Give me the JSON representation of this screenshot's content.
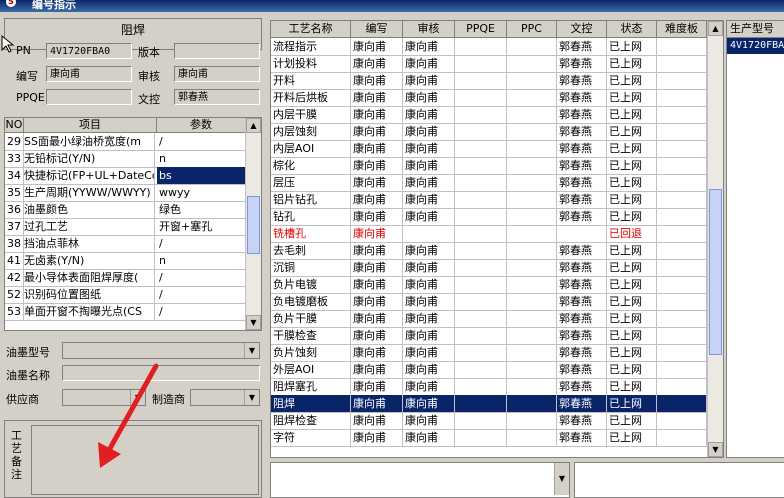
{
  "window": {
    "title": "编号指示"
  },
  "left_panel": {
    "section_title": "阻焊",
    "fields": {
      "pn_label": "PN",
      "pn_value": "4V1720FBA0",
      "version_label": "版本",
      "version_value": "",
      "author_label": "编写",
      "author_value": "康向甫",
      "reviewer_label": "审核",
      "reviewer_value": "康向甫",
      "ppqe_label": "PPQE",
      "ppqe_value": "",
      "control_label": "文控",
      "control_value": "郭春燕"
    },
    "param_table": {
      "headers": [
        "NO",
        "项目",
        "参数"
      ],
      "rows": [
        {
          "no": "29",
          "item": "SS面最小绿油桥宽度(m",
          "val": "/"
        },
        {
          "no": "33",
          "item": "无铅标记(Y/N)",
          "val": "n"
        },
        {
          "no": "34",
          "item": "快捷标记(FP+UL+DateCo",
          "val": "bs",
          "selected": true
        },
        {
          "no": "35",
          "item": "生产周期(YYWW/WWYY)",
          "val": "wwyy"
        },
        {
          "no": "36",
          "item": "油墨颜色",
          "val": "绿色"
        },
        {
          "no": "37",
          "item": "过孔工艺",
          "val": "开窗+塞孔"
        },
        {
          "no": "38",
          "item": "挡油点菲林",
          "val": "/"
        },
        {
          "no": "41",
          "item": "无卤素(Y/N)",
          "val": "n"
        },
        {
          "no": "42",
          "item": "最小导体表面阻焊厚度(",
          "val": "/"
        },
        {
          "no": "52",
          "item": "识别码位置图纸",
          "val": "/"
        },
        {
          "no": "53",
          "item": "单面开窗不掏曝光点(CS",
          "val": "/"
        }
      ]
    },
    "ink_model_label": "油墨型号",
    "ink_name_label": "油墨名称",
    "supplier_label": "供应商",
    "manufacturer_label": "制造商",
    "memo_label": "工艺备注"
  },
  "grid": {
    "headers": [
      "工艺名称",
      "编写",
      "审核",
      "PPQE",
      "PPC",
      "文控",
      "状态",
      "难度板"
    ],
    "rows": [
      {
        "name": "流程指示",
        "author": "康向甫",
        "reviewer": "康向甫",
        "ppqe": "",
        "ppc": "",
        "control": "郭春燕",
        "status": "已上网",
        "diff": ""
      },
      {
        "name": "计划投料",
        "author": "康向甫",
        "reviewer": "康向甫",
        "ppqe": "",
        "ppc": "",
        "control": "郭春燕",
        "status": "已上网",
        "diff": ""
      },
      {
        "name": "开料",
        "author": "康向甫",
        "reviewer": "康向甫",
        "ppqe": "",
        "ppc": "",
        "control": "郭春燕",
        "status": "已上网",
        "diff": ""
      },
      {
        "name": "开料后烘板",
        "author": "康向甫",
        "reviewer": "康向甫",
        "ppqe": "",
        "ppc": "",
        "control": "郭春燕",
        "status": "已上网",
        "diff": ""
      },
      {
        "name": "内层干膜",
        "author": "康向甫",
        "reviewer": "康向甫",
        "ppqe": "",
        "ppc": "",
        "control": "郭春燕",
        "status": "已上网",
        "diff": ""
      },
      {
        "name": "内层蚀刻",
        "author": "康向甫",
        "reviewer": "康向甫",
        "ppqe": "",
        "ppc": "",
        "control": "郭春燕",
        "status": "已上网",
        "diff": ""
      },
      {
        "name": "内层AOI",
        "author": "康向甫",
        "reviewer": "康向甫",
        "ppqe": "",
        "ppc": "",
        "control": "郭春燕",
        "status": "已上网",
        "diff": ""
      },
      {
        "name": "棕化",
        "author": "康向甫",
        "reviewer": "康向甫",
        "ppqe": "",
        "ppc": "",
        "control": "郭春燕",
        "status": "已上网",
        "diff": ""
      },
      {
        "name": "层压",
        "author": "康向甫",
        "reviewer": "康向甫",
        "ppqe": "",
        "ppc": "",
        "control": "郭春燕",
        "status": "已上网",
        "diff": ""
      },
      {
        "name": "铝片钻孔",
        "author": "康向甫",
        "reviewer": "康向甫",
        "ppqe": "",
        "ppc": "",
        "control": "郭春燕",
        "status": "已上网",
        "diff": ""
      },
      {
        "name": "钻孔",
        "author": "康向甫",
        "reviewer": "康向甫",
        "ppqe": "",
        "ppc": "",
        "control": "郭春燕",
        "status": "已上网",
        "diff": ""
      },
      {
        "name": "铣槽孔",
        "author": "康向甫",
        "reviewer": "",
        "ppqe": "",
        "ppc": "",
        "control": "",
        "status": "已回退",
        "diff": "",
        "red": true
      },
      {
        "name": "去毛刺",
        "author": "康向甫",
        "reviewer": "康向甫",
        "ppqe": "",
        "ppc": "",
        "control": "郭春燕",
        "status": "已上网",
        "diff": ""
      },
      {
        "name": "沉铜",
        "author": "康向甫",
        "reviewer": "康向甫",
        "ppqe": "",
        "ppc": "",
        "control": "郭春燕",
        "status": "已上网",
        "diff": ""
      },
      {
        "name": "负片电镀",
        "author": "康向甫",
        "reviewer": "康向甫",
        "ppqe": "",
        "ppc": "",
        "control": "郭春燕",
        "status": "已上网",
        "diff": ""
      },
      {
        "name": "负电镀磨板",
        "author": "康向甫",
        "reviewer": "康向甫",
        "ppqe": "",
        "ppc": "",
        "control": "郭春燕",
        "status": "已上网",
        "diff": ""
      },
      {
        "name": "负片干膜",
        "author": "康向甫",
        "reviewer": "康向甫",
        "ppqe": "",
        "ppc": "",
        "control": "郭春燕",
        "status": "已上网",
        "diff": ""
      },
      {
        "name": "干膜检查",
        "author": "康向甫",
        "reviewer": "康向甫",
        "ppqe": "",
        "ppc": "",
        "control": "郭春燕",
        "status": "已上网",
        "diff": ""
      },
      {
        "name": "负片蚀刻",
        "author": "康向甫",
        "reviewer": "康向甫",
        "ppqe": "",
        "ppc": "",
        "control": "郭春燕",
        "status": "已上网",
        "diff": ""
      },
      {
        "name": "外层AOI",
        "author": "康向甫",
        "reviewer": "康向甫",
        "ppqe": "",
        "ppc": "",
        "control": "郭春燕",
        "status": "已上网",
        "diff": ""
      },
      {
        "name": "阻焊塞孔",
        "author": "康向甫",
        "reviewer": "康向甫",
        "ppqe": "",
        "ppc": "",
        "control": "郭春燕",
        "status": "已上网",
        "diff": ""
      },
      {
        "name": "阻焊",
        "author": "康向甫",
        "reviewer": "康向甫",
        "ppqe": "",
        "ppc": "",
        "control": "郭春燕",
        "status": "已上网",
        "diff": "",
        "selected": true
      },
      {
        "name": "阻焊检查",
        "author": "康向甫",
        "reviewer": "康向甫",
        "ppqe": "",
        "ppc": "",
        "control": "郭春燕",
        "status": "已上网",
        "diff": ""
      },
      {
        "name": "字符",
        "author": "康向甫",
        "reviewer": "康向甫",
        "ppqe": "",
        "ppc": "",
        "control": "郭春燕",
        "status": "已上网",
        "diff": ""
      }
    ]
  },
  "right_panel": {
    "header": "生产型号",
    "value": "4V1720FBA0"
  },
  "colors": {
    "selection": "#0a246a",
    "warning_text": "#e00000",
    "annotation_arrow": "#e02020"
  }
}
